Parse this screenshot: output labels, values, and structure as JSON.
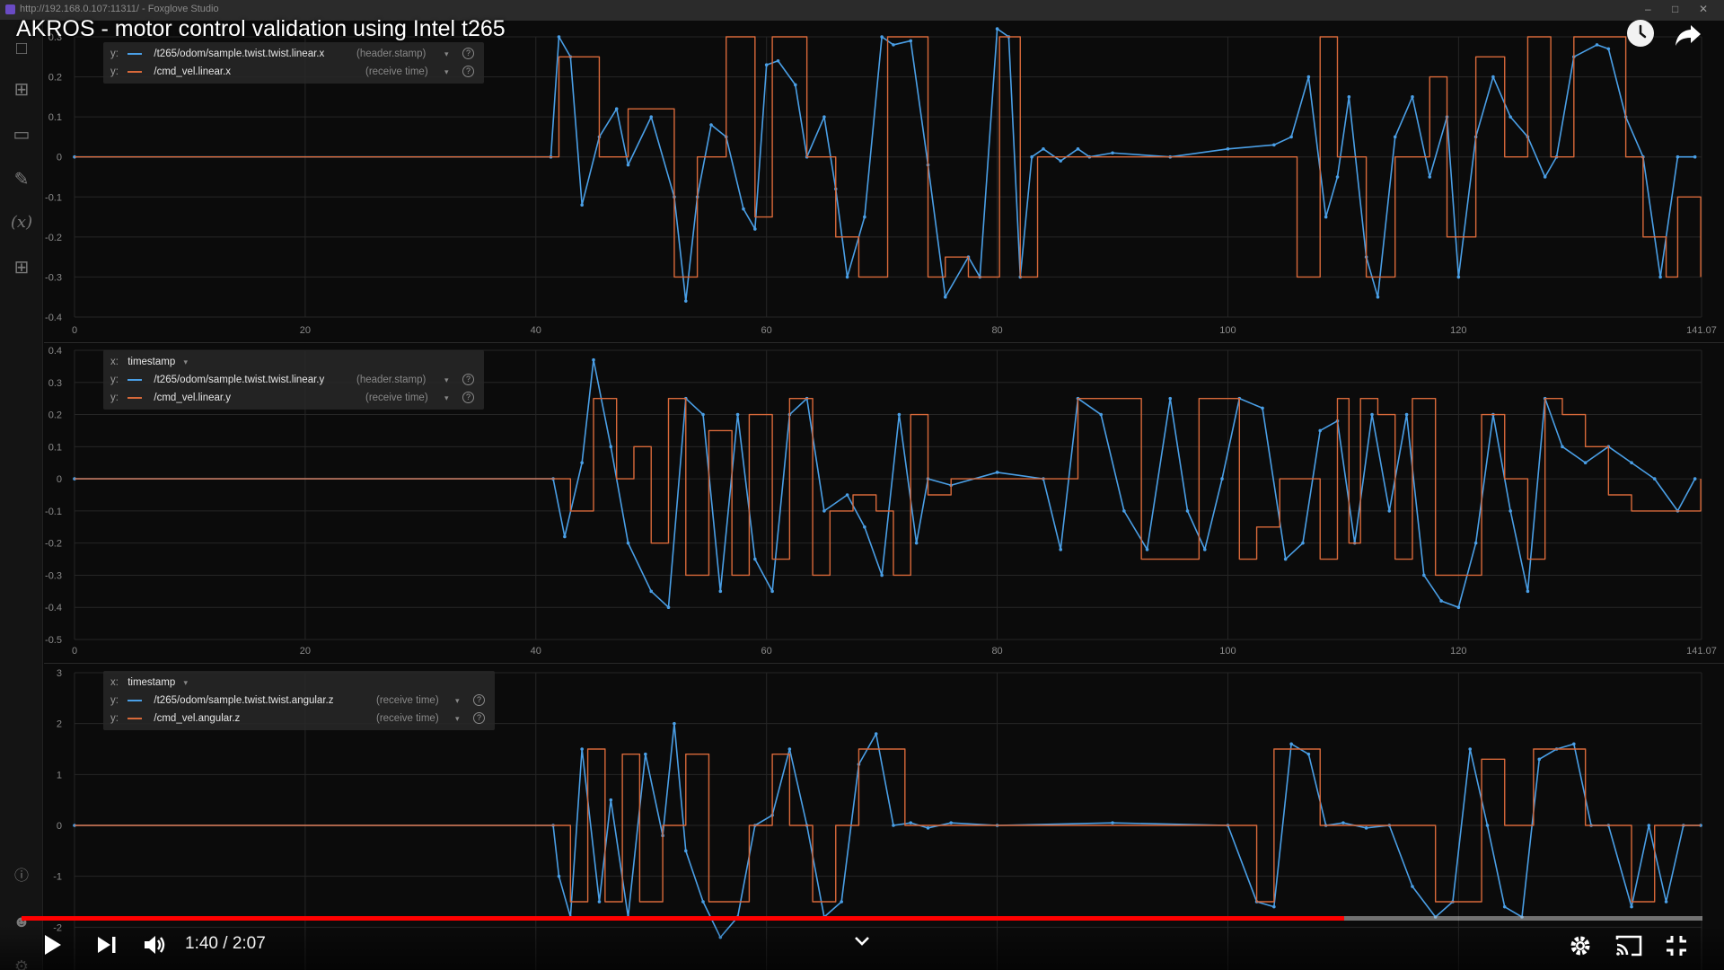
{
  "browser": {
    "url": "http://192.168.0.107:11311/ - Foxglove Studio"
  },
  "video": {
    "title": "AKROS - motor control validation using Intel t265",
    "current_time": "1:40",
    "duration": "2:07",
    "time_display": "1:40 / 2:07",
    "progress": 0.787
  },
  "sidebar": {
    "icons": [
      "layers-icon",
      "table-icon",
      "display-icon",
      "note-icon",
      "variables-icon",
      "extensions-icon",
      "help-icon",
      "account-icon",
      "settings-icon"
    ],
    "variables_label": "(x)"
  },
  "colors": {
    "measured": "#4a9fe6",
    "command": "#d8693a",
    "grid": "#262626",
    "progress": "#ff0000"
  },
  "chart_data": [
    {
      "type": "line",
      "legend": {
        "rows": [
          {
            "axis": "y:",
            "topic": "/t265/odom/sample.twist.twist.linear.x",
            "timestamp": "(header.stamp)"
          },
          {
            "axis": "y:",
            "topic": "/cmd_vel.linear.x",
            "timestamp": "(receive time)"
          }
        ]
      },
      "xlim": [
        0,
        141.07
      ],
      "x_ticks": [
        "0",
        "20",
        "40",
        "60",
        "80",
        "100",
        "120",
        "141.07"
      ],
      "ylim": [
        -0.4,
        0.3
      ],
      "y_ticks": [
        "0.3",
        "0.2",
        "0.1",
        "0",
        "-0.1",
        "-0.2",
        "-0.3",
        "-0.4"
      ],
      "series": [
        {
          "name": "/t265/odom/sample.twist.twist.linear.x",
          "color": "#4a9fe6",
          "x": [
            0,
            41.3,
            42,
            43,
            44,
            45.5,
            47,
            48,
            50,
            52,
            53,
            54,
            55.2,
            56.5,
            58,
            59,
            60,
            61,
            62.5,
            63.5,
            65,
            66,
            67,
            68.5,
            70,
            71,
            72.5,
            74,
            75.5,
            77.5,
            78.5,
            80,
            81,
            82,
            83,
            84,
            85.5,
            87,
            88,
            90,
            95,
            100,
            104,
            105.5,
            107,
            108.5,
            109.5,
            110.5,
            112,
            113,
            114.5,
            116,
            117.5,
            119,
            120,
            121.5,
            123,
            124.5,
            126,
            127.5,
            128.5,
            130,
            132,
            133,
            134.5,
            136,
            137.5,
            139,
            140.5
          ],
          "y": [
            0.0,
            0.0,
            0.3,
            0.25,
            -0.12,
            0.05,
            0.12,
            -0.02,
            0.1,
            -0.1,
            -0.36,
            -0.1,
            0.08,
            0.05,
            -0.13,
            -0.18,
            0.23,
            0.24,
            0.18,
            0.0,
            0.1,
            -0.08,
            -0.3,
            -0.15,
            0.3,
            0.28,
            0.29,
            -0.02,
            -0.35,
            -0.25,
            -0.3,
            0.32,
            0.3,
            -0.3,
            0.0,
            0.02,
            -0.01,
            0.02,
            0.0,
            0.01,
            0.0,
            0.02,
            0.03,
            0.05,
            0.2,
            -0.15,
            -0.05,
            0.15,
            -0.25,
            -0.35,
            0.05,
            0.15,
            -0.05,
            0.1,
            -0.3,
            0.05,
            0.2,
            0.1,
            0.05,
            -0.05,
            0.0,
            0.25,
            0.28,
            0.27,
            0.1,
            0.0,
            -0.3,
            0.0,
            0.0
          ]
        },
        {
          "name": "/cmd_vel.linear.x",
          "color": "#d8693a",
          "x": [
            0,
            41.3,
            42,
            45.5,
            48,
            52,
            54,
            56.5,
            59,
            60.5,
            63.5,
            66,
            68,
            70.5,
            74,
            75.5,
            77.5,
            80.2,
            82,
            83.5,
            104.5,
            106,
            108,
            109.5,
            112,
            113,
            114.5,
            117.5,
            119,
            121.5,
            124,
            126,
            128,
            130,
            132.5,
            134.5,
            136,
            138,
            139,
            141
          ],
          "y": [
            0.0,
            0.0,
            0.25,
            0.0,
            0.12,
            -0.3,
            0.0,
            0.3,
            -0.15,
            0.3,
            0.0,
            -0.2,
            -0.3,
            0.3,
            -0.3,
            -0.25,
            -0.3,
            0.3,
            -0.3,
            0.0,
            0.0,
            -0.3,
            0.3,
            0.0,
            -0.3,
            -0.3,
            0.0,
            0.2,
            -0.2,
            0.25,
            0.0,
            0.3,
            0.0,
            0.3,
            0.3,
            0.0,
            -0.2,
            -0.3,
            -0.1,
            -0.3
          ]
        }
      ]
    },
    {
      "type": "line",
      "legend": {
        "x_label": "x:",
        "x_value": "timestamp",
        "rows": [
          {
            "axis": "y:",
            "topic": "/t265/odom/sample.twist.twist.linear.y",
            "timestamp": "(header.stamp)"
          },
          {
            "axis": "y:",
            "topic": "/cmd_vel.linear.y",
            "timestamp": "(receive time)"
          }
        ]
      },
      "xlim": [
        0,
        141.07
      ],
      "x_ticks": [
        "0",
        "20",
        "40",
        "60",
        "80",
        "100",
        "120",
        "141.07"
      ],
      "ylim": [
        -0.5,
        0.4
      ],
      "y_ticks": [
        "0.4",
        "0.3",
        "0.2",
        "0.1",
        "0",
        "-0.1",
        "-0.2",
        "-0.3",
        "-0.4",
        "-0.5"
      ],
      "series": [
        {
          "name": "/t265/odom/sample.twist.twist.linear.y",
          "color": "#4a9fe6",
          "x": [
            0,
            41.5,
            42.5,
            44,
            45,
            46.5,
            48,
            50,
            51.5,
            53,
            54.5,
            56,
            57.5,
            59,
            60.5,
            62,
            63.5,
            65,
            67,
            68.5,
            70,
            71.5,
            73,
            74,
            76,
            80,
            84,
            85.5,
            87,
            89,
            91,
            93,
            95,
            96.5,
            98,
            99.5,
            101,
            103,
            105,
            106.5,
            108,
            109.5,
            111,
            112.5,
            114,
            115.5,
            117,
            118.5,
            120,
            121.5,
            123,
            124.5,
            126,
            127.5,
            129,
            131,
            133,
            135,
            137,
            139,
            140.5
          ],
          "y": [
            0.0,
            0.0,
            -0.18,
            0.05,
            0.37,
            0.1,
            -0.2,
            -0.35,
            -0.4,
            0.25,
            0.2,
            -0.35,
            0.2,
            -0.25,
            -0.35,
            0.2,
            0.25,
            -0.1,
            -0.05,
            -0.15,
            -0.3,
            0.2,
            -0.2,
            0.0,
            -0.02,
            0.02,
            0.0,
            -0.22,
            0.25,
            0.2,
            -0.1,
            -0.22,
            0.25,
            -0.1,
            -0.22,
            0.0,
            0.25,
            0.22,
            -0.25,
            -0.2,
            0.15,
            0.18,
            -0.2,
            0.2,
            -0.1,
            0.2,
            -0.3,
            -0.38,
            -0.4,
            -0.2,
            0.2,
            -0.1,
            -0.35,
            0.25,
            0.1,
            0.05,
            0.1,
            0.05,
            0.0,
            -0.1,
            0.0
          ]
        },
        {
          "name": "/cmd_vel.linear.y",
          "color": "#d8693a",
          "x": [
            0,
            41.5,
            43,
            45,
            47,
            48.5,
            50,
            51.5,
            53,
            55,
            57,
            58.5,
            60.5,
            62,
            64,
            65.5,
            67.5,
            69.5,
            71,
            72.5,
            74,
            76,
            85,
            87,
            89.5,
            92.5,
            94.5,
            97.5,
            99.5,
            101,
            102.5,
            104.5,
            106,
            108,
            109.5,
            110.5,
            111.5,
            113,
            114.5,
            116,
            118,
            120,
            122,
            124,
            126,
            127.5,
            129,
            131,
            133,
            135,
            137,
            141
          ],
          "y": [
            0.0,
            0.0,
            -0.1,
            0.25,
            0.0,
            0.1,
            -0.2,
            0.25,
            -0.3,
            0.15,
            -0.3,
            0.2,
            -0.25,
            0.25,
            -0.3,
            -0.1,
            -0.05,
            -0.1,
            -0.3,
            0.2,
            -0.05,
            0.0,
            0.0,
            0.25,
            0.25,
            -0.25,
            -0.25,
            0.25,
            0.25,
            -0.25,
            -0.15,
            0.0,
            0.0,
            -0.25,
            0.25,
            -0.2,
            0.25,
            0.2,
            -0.25,
            0.25,
            -0.3,
            -0.3,
            0.2,
            0.0,
            -0.25,
            0.25,
            0.2,
            0.1,
            -0.05,
            -0.1,
            -0.1,
            0.0
          ]
        }
      ]
    },
    {
      "type": "line",
      "legend": {
        "x_label": "x:",
        "x_value": "timestamp",
        "rows": [
          {
            "axis": "y:",
            "topic": "/t265/odom/sample.twist.twist.angular.z",
            "timestamp": "(receive time)"
          },
          {
            "axis": "y:",
            "topic": "/cmd_vel.angular.z",
            "timestamp": "(receive time)"
          }
        ]
      },
      "xlim": [
        0,
        141.07
      ],
      "x_ticks": [
        "0",
        "20",
        "40",
        "60",
        "80",
        "100",
        "120",
        "141.07"
      ],
      "ylim": [
        -3,
        3
      ],
      "y_ticks": [
        "3",
        "2",
        "1",
        "0",
        "-1",
        "-2"
      ],
      "series": [
        {
          "name": "/t265/odom/sample.twist.twist.angular.z",
          "color": "#4a9fe6",
          "x": [
            0,
            41.5,
            42,
            43,
            44,
            45.5,
            46.5,
            48,
            49.5,
            51,
            52,
            53,
            54.5,
            56,
            57.5,
            59,
            60.5,
            62,
            63.5,
            65,
            66.5,
            68,
            69.5,
            71,
            72.5,
            74,
            76,
            80,
            90,
            100,
            102.5,
            104,
            105.5,
            107,
            108.5,
            110,
            112,
            114,
            116,
            118,
            119.5,
            121,
            122.5,
            124,
            125.5,
            127,
            128.5,
            130,
            131.5,
            133,
            135,
            136.5,
            138,
            139.5,
            141
          ],
          "y": [
            0.0,
            0.0,
            -1.0,
            -1.8,
            1.5,
            -1.5,
            0.5,
            -1.8,
            1.4,
            -0.2,
            2.0,
            -0.5,
            -1.5,
            -2.2,
            -1.8,
            0.0,
            0.2,
            1.5,
            0.0,
            -1.8,
            -1.5,
            1.2,
            1.8,
            0.0,
            0.05,
            -0.05,
            0.05,
            0.0,
            0.05,
            0.0,
            -1.5,
            -1.6,
            1.6,
            1.4,
            0.0,
            0.05,
            -0.05,
            0.0,
            -1.2,
            -1.8,
            -1.5,
            1.5,
            0.0,
            -1.6,
            -1.8,
            1.3,
            1.5,
            1.6,
            0.0,
            0.0,
            -1.6,
            0.0,
            -1.5,
            0.0,
            0.0
          ]
        },
        {
          "name": "/cmd_vel.angular.z",
          "color": "#d8693a",
          "x": [
            0,
            41.5,
            43,
            44.5,
            46,
            47.5,
            49,
            51,
            53,
            55,
            57,
            58.5,
            60.5,
            62,
            64,
            66,
            68,
            70,
            72,
            76,
            102.5,
            104,
            106,
            108,
            116,
            118,
            120,
            122,
            124,
            126.5,
            128.5,
            131,
            133,
            135,
            137,
            139,
            141
          ],
          "y": [
            0.0,
            0.0,
            -1.5,
            1.5,
            -1.5,
            1.4,
            -1.5,
            0.0,
            1.4,
            -1.5,
            -1.5,
            0.0,
            1.4,
            0.0,
            -1.5,
            0.0,
            1.5,
            1.5,
            0.0,
            0.0,
            -1.5,
            1.5,
            1.5,
            0.0,
            0.0,
            -1.5,
            -1.5,
            1.3,
            0.0,
            1.5,
            1.5,
            0.0,
            0.0,
            -1.5,
            0.0,
            0.0,
            0.0
          ]
        }
      ]
    }
  ]
}
